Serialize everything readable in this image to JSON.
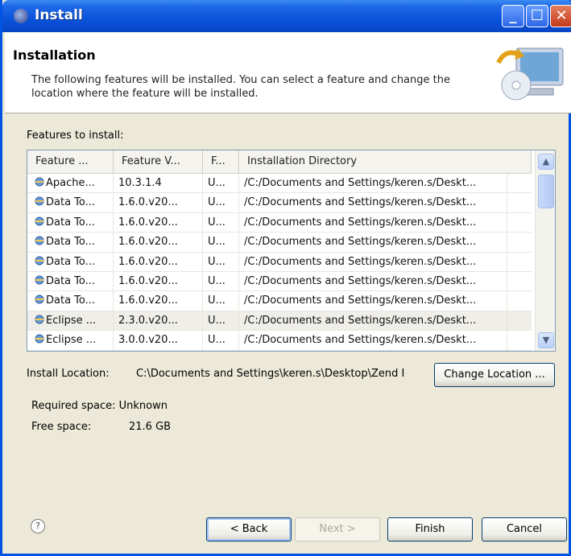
{
  "window": {
    "title": "Install"
  },
  "header": {
    "title": "Installation",
    "description": "The following features will be installed. You can select a feature and change the location where the feature will be installed."
  },
  "features_label": "Features to install:",
  "table": {
    "columns": [
      "Feature ...",
      "Feature V...",
      "F...",
      "Installation Directory"
    ],
    "rows": [
      [
        "Apache...",
        "10.3.1.4",
        "U...",
        "/C:/Documents and Settings/keren.s/Deskt..."
      ],
      [
        "Data To...",
        "1.6.0.v20...",
        "U...",
        "/C:/Documents and Settings/keren.s/Deskt..."
      ],
      [
        "Data To...",
        "1.6.0.v20...",
        "U...",
        "/C:/Documents and Settings/keren.s/Deskt..."
      ],
      [
        "Data To...",
        "1.6.0.v20...",
        "U...",
        "/C:/Documents and Settings/keren.s/Deskt..."
      ],
      [
        "Data To...",
        "1.6.0.v20...",
        "U...",
        "/C:/Documents and Settings/keren.s/Deskt..."
      ],
      [
        "Data To...",
        "1.6.0.v20...",
        "U...",
        "/C:/Documents and Settings/keren.s/Deskt..."
      ],
      [
        "Data To...",
        "1.6.0.v20...",
        "U...",
        "/C:/Documents and Settings/keren.s/Deskt..."
      ],
      [
        "Eclipse ...",
        "2.3.0.v20...",
        "U...",
        "/C:/Documents and Settings/keren.s/Deskt..."
      ],
      [
        "Eclipse ...",
        "3.0.0.v20...",
        "U...",
        "/C:/Documents and Settings/keren.s/Deskt..."
      ]
    ],
    "selected_row": 7
  },
  "install_location": {
    "label": "Install Location:",
    "value": "C:\\Documents and Settings\\keren.s\\Desktop\\Zend I",
    "button": "Change Location ..."
  },
  "space": {
    "required": "Required space: Unknown",
    "free_label": "Free space:",
    "free_value": "21.6 GB"
  },
  "buttons": {
    "help": "?",
    "back": "< Back",
    "next": "Next >",
    "finish": "Finish",
    "cancel": "Cancel"
  },
  "icons": {
    "window": "eclipse-icon",
    "header": "install-computer-icon",
    "feature": "feature-plugin-icon"
  },
  "colors": {
    "titlebar": "#0a53dc",
    "dialog_bg": "#ece9d8",
    "close": "#c3391c"
  }
}
